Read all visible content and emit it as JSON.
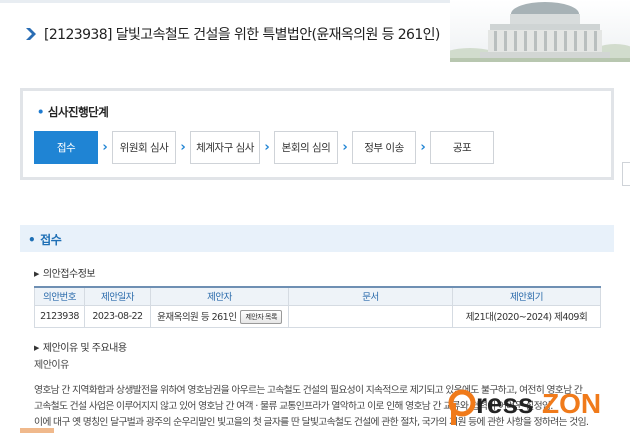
{
  "header": {
    "title": "[2123938] 달빛고속철도 건설을 위한 특별법안(윤재옥의원 등 261인)"
  },
  "stages": {
    "heading": "심사진행단계",
    "steps": [
      {
        "label": "접수",
        "active": true
      },
      {
        "label": "위원회 심사",
        "active": false
      },
      {
        "label": "체계자구 심사",
        "active": false
      },
      {
        "label": "본회의 심의",
        "active": false
      },
      {
        "label": "정부 이송",
        "active": false
      },
      {
        "label": "공포",
        "active": false
      }
    ]
  },
  "section": {
    "title": "접수",
    "receipt_info_label": "의안접수정보",
    "reason_heading": "제안이유 및 주요내용",
    "reason_label": "제안이유"
  },
  "table": {
    "headers": [
      "의안번호",
      "제안일자",
      "제안자",
      "문서",
      "제안회기"
    ],
    "row": {
      "bill_no": "2123938",
      "date": "2023-08-22",
      "proposer": "윤재옥의원 등 261인",
      "proposer_button": "제안자 목록",
      "document": "",
      "session": "제21대(2020~2024) 제409회"
    }
  },
  "body": {
    "lines": [
      "영호남 간 지역화합과 상생발전을 위하여 영호남권을 아우르는 고속철도 건설의 필요성이 지속적으로 제기되고 있음에도 불구하고, 여전히 영호남 간",
      "고속철도 건설 사업은 이루어지지 않고 있어 영호남 간 여객 · 물류 교통인프라가 열악하고 이로 인해 영호남 간 교류와 협력이 어려운 실정임.",
      "이에 대구 옛 명칭인 달구벌과 광주의 순우리말인 빛고을의 첫 글자를 딴 달빛고속철도 건설에 관한 절차, 국가의 지원 등에 관한 사항을 정하려는 것임."
    ]
  },
  "watermark": {
    "text_a": "ress",
    "text_b": "ZON"
  },
  "colors": {
    "accent": "#1f84d4",
    "section_bg": "#e8f1fa",
    "section_text": "#1e6fb5",
    "watermark_orange": "#f07a1a"
  }
}
